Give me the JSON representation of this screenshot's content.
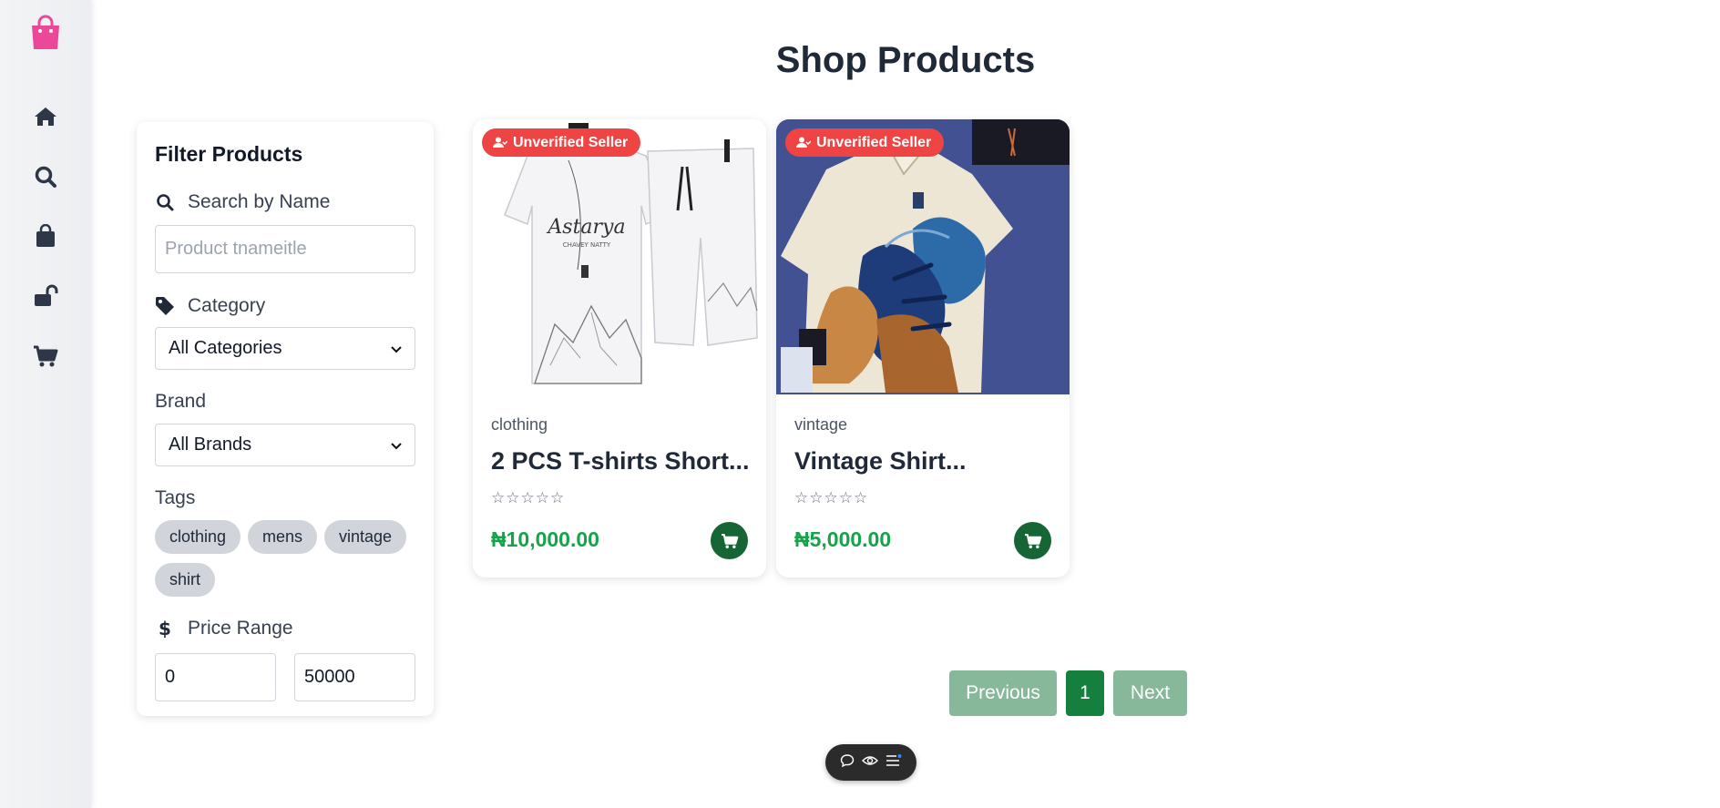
{
  "page": {
    "title": "Shop Products"
  },
  "sidebar": {
    "items": [
      {
        "name": "logo",
        "icon": "shopping-bag-icon",
        "color": "#ec4899"
      },
      {
        "name": "home",
        "icon": "home-icon"
      },
      {
        "name": "search",
        "icon": "search-icon"
      },
      {
        "name": "shop",
        "icon": "bag-icon"
      },
      {
        "name": "unlock",
        "icon": "unlock-icon"
      },
      {
        "name": "cart",
        "icon": "cart-icon"
      }
    ]
  },
  "filters": {
    "title": "Filter Products",
    "search": {
      "label": "Search by Name",
      "placeholder": "Product tnameitle",
      "value": ""
    },
    "category": {
      "label": "Category",
      "selected": "All Categories"
    },
    "brand": {
      "label": "Brand",
      "selected": "All Brands"
    },
    "tags": {
      "label": "Tags",
      "items": [
        "clothing",
        "mens",
        "vintage",
        "shirt"
      ]
    },
    "price": {
      "label": "Price Range",
      "min": "0",
      "max": "50000"
    }
  },
  "products": [
    {
      "badge": "Unverified Seller",
      "category": "clothing",
      "name": "2 PCS T-shirts Short...",
      "stars": "☆☆☆☆☆",
      "price": "₦10,000.00"
    },
    {
      "badge": "Unverified Seller",
      "category": "vintage",
      "name": "Vintage Shirt...",
      "stars": "☆☆☆☆☆",
      "price": "₦5,000.00"
    }
  ],
  "pagination": {
    "previous": "Previous",
    "current": "1",
    "next": "Next"
  },
  "colors": {
    "accent": "#166534",
    "price": "#16a34a",
    "badge": "#ef4444",
    "pagination_active": "#15803d",
    "pagination_disabled": "#86b899"
  }
}
